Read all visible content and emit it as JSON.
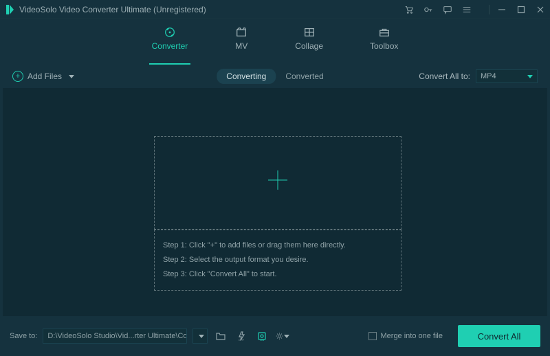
{
  "title": "VideoSolo Video Converter Ultimate (Unregistered)",
  "tabs": [
    {
      "label": "Converter"
    },
    {
      "label": "MV"
    },
    {
      "label": "Collage"
    },
    {
      "label": "Toolbox"
    }
  ],
  "subbar": {
    "add_files": "Add Files",
    "seg_converting": "Converting",
    "seg_converted": "Converted",
    "convert_all_to_label": "Convert All to:",
    "format_selected": "MP4"
  },
  "steps": {
    "s1": "Step 1: Click \"+\" to add files or drag them here directly.",
    "s2": "Step 2: Select the output format you desire.",
    "s3": "Step 3: Click \"Convert All\" to start."
  },
  "footer": {
    "save_to_label": "Save to:",
    "save_path": "D:\\VideoSolo Studio\\Vid...rter Ultimate\\Converted",
    "merge_label": "Merge into one file",
    "convert_btn": "Convert All"
  }
}
